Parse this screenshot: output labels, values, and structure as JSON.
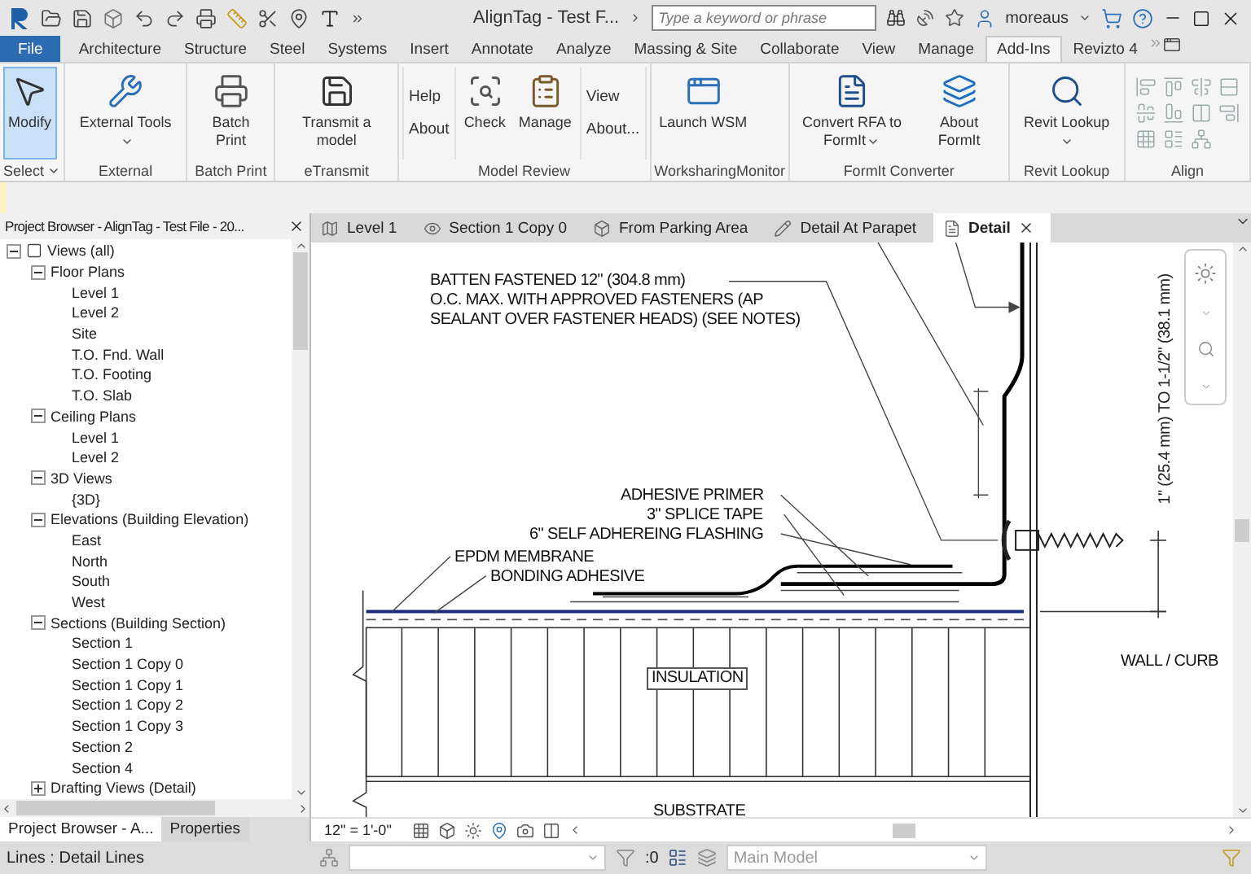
{
  "title_bar": {
    "title": "AlignTag - Test F...",
    "search": {
      "placeholder": "Type a keyword or phrase"
    },
    "user": "moreaus"
  },
  "ribbon_tabs": [
    {
      "label": "File",
      "kind": "file",
      "selected": false
    },
    {
      "label": "Architecture",
      "kind": "tab",
      "selected": false
    },
    {
      "label": "Structure",
      "kind": "tab",
      "selected": false
    },
    {
      "label": "Steel",
      "kind": "tab",
      "selected": false
    },
    {
      "label": "Systems",
      "kind": "tab",
      "selected": false
    },
    {
      "label": "Insert",
      "kind": "tab",
      "selected": false
    },
    {
      "label": "Annotate",
      "kind": "tab",
      "selected": false
    },
    {
      "label": "Analyze",
      "kind": "tab",
      "selected": false
    },
    {
      "label": "Massing & Site",
      "kind": "tab",
      "selected": false
    },
    {
      "label": "Collaborate",
      "kind": "tab",
      "selected": false
    },
    {
      "label": "View",
      "kind": "tab",
      "selected": false
    },
    {
      "label": "Manage",
      "kind": "tab",
      "selected": false
    },
    {
      "label": "Add-Ins",
      "kind": "tab",
      "selected": true
    },
    {
      "label": "Revizto 4",
      "kind": "tab",
      "selected": false
    }
  ],
  "ribbon_panels": [
    {
      "title": "Select",
      "dropdown": true,
      "items": [
        {
          "kind": "large",
          "label": "Modify",
          "selected": true
        }
      ]
    },
    {
      "title": "External",
      "items": [
        {
          "kind": "large",
          "label": "External Tools",
          "dropdown": true,
          "selected": false
        }
      ]
    },
    {
      "title": "Batch Print",
      "items": [
        {
          "kind": "large",
          "label": "Batch Print",
          "selected": false
        }
      ]
    },
    {
      "title": "eTransmit",
      "items": [
        {
          "kind": "large",
          "label": "Transmit a model",
          "selected": false
        }
      ]
    },
    {
      "title": "Model Review",
      "items": [
        {
          "kind": "stack",
          "labels": [
            "Help",
            "About"
          ]
        },
        {
          "kind": "large",
          "label": "Check",
          "selected": false
        },
        {
          "kind": "large",
          "label": "Manage",
          "selected": false
        },
        {
          "kind": "stack",
          "labels": [
            "View",
            "About..."
          ]
        }
      ]
    },
    {
      "title": "WorksharingMonitor",
      "items": [
        {
          "kind": "large",
          "label": "Launch WSM",
          "selected": false
        }
      ]
    },
    {
      "title": "FormIt Converter",
      "items": [
        {
          "kind": "large",
          "label": "Convert RFA to FormIt",
          "dropdown": true,
          "selected": false
        },
        {
          "kind": "large",
          "label": "About FormIt",
          "selected": false
        }
      ]
    },
    {
      "title": "Revit Lookup",
      "items": [
        {
          "kind": "large",
          "label": "Revit Lookup",
          "dropdown": true,
          "selected": false
        }
      ]
    },
    {
      "title": "Align",
      "items": [
        {
          "kind": "icon_grid"
        }
      ]
    }
  ],
  "project_browser": {
    "title": "Project Browser - AlignTag - Test File - 20...",
    "tree": [
      {
        "label": "Views (all)",
        "expanded": true,
        "children": [
          {
            "label": "Floor Plans",
            "expanded": true,
            "children": [
              {
                "label": "Level 1"
              },
              {
                "label": "Level 2"
              },
              {
                "label": "Site"
              },
              {
                "label": "T.O. Fnd. Wall"
              },
              {
                "label": "T.O. Footing"
              },
              {
                "label": "T.O. Slab"
              }
            ]
          },
          {
            "label": "Ceiling Plans",
            "expanded": true,
            "children": [
              {
                "label": "Level 1"
              },
              {
                "label": "Level 2"
              }
            ]
          },
          {
            "label": "3D Views",
            "expanded": true,
            "children": [
              {
                "label": "{3D}"
              }
            ]
          },
          {
            "label": "Elevations (Building Elevation)",
            "expanded": true,
            "children": [
              {
                "label": "East"
              },
              {
                "label": "North"
              },
              {
                "label": "South"
              },
              {
                "label": "West"
              }
            ]
          },
          {
            "label": "Sections (Building Section)",
            "expanded": true,
            "children": [
              {
                "label": "Section 1"
              },
              {
                "label": "Section 1 Copy 0"
              },
              {
                "label": "Section 1 Copy 1"
              },
              {
                "label": "Section 1 Copy 2"
              },
              {
                "label": "Section 1 Copy 3"
              },
              {
                "label": "Section 2"
              },
              {
                "label": "Section 4"
              }
            ]
          },
          {
            "label": "Drafting Views (Detail)",
            "expanded": false
          }
        ]
      }
    ],
    "tabs": [
      {
        "label": "Project Browser - A...",
        "selected": true
      },
      {
        "label": "Properties",
        "selected": false
      }
    ]
  },
  "view_tabs": [
    {
      "label": "Level 1",
      "selected": false
    },
    {
      "label": "Section 1 Copy 0",
      "selected": false
    },
    {
      "label": "From Parking Area",
      "selected": false
    },
    {
      "label": "Detail At Parapet",
      "selected": false
    },
    {
      "label": "Detail",
      "selected": true
    }
  ],
  "drawing": {
    "batten_note": [
      "BATTEN FASTENED 12\" (304.8 mm)",
      "O.C. MAX. WITH APPROVED FASTENERS (AP",
      "SEALANT OVER FASTENER HEADS) (SEE NOTES)"
    ],
    "dimension": "1\" (25.4 mm) TO 1-1/2\" (38.1 mm)",
    "layer_notes": [
      "ADHESIVE PRIMER",
      "3\" SPLICE TAPE",
      "6\" SELF ADHEREING FLASHING"
    ],
    "membrane_notes": [
      "EPDM MEMBRANE",
      "BONDING ADHESIVE"
    ],
    "insulation": "INSULATION",
    "wall": "WALL / CURB",
    "substrate": "SUBSTRATE"
  },
  "view_control_bar": {
    "scale": "12\" = 1'-0\""
  },
  "status_bar": {
    "text": "Lines : Detail Lines",
    "selection_count": ":0",
    "workset": {
      "value": "Main Model",
      "disabled": true
    }
  }
}
